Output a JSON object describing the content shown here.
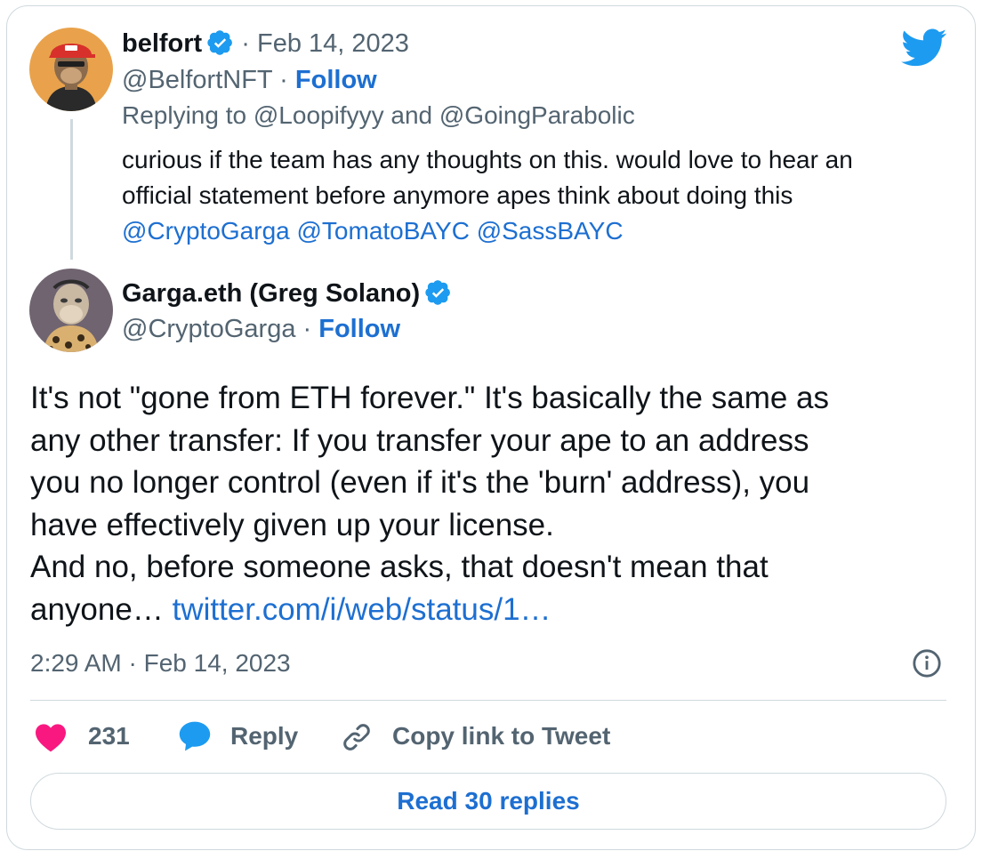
{
  "colors": {
    "link": "#1d6fd1",
    "twitter_blue": "#1d9bf0",
    "like_red": "#f91880",
    "muted": "#536471",
    "border": "#cfd9de"
  },
  "reply_tweet": {
    "author_name": "belfort",
    "dot_date": "· Feb 14, 2023",
    "handle": "@BelfortNFT",
    "dot": "·",
    "follow_label": "Follow",
    "replying_prefix": "Replying to",
    "replying_user1": "@Loopifyyy",
    "replying_and": "and",
    "replying_user2": "@GoingParabolic",
    "text_line1": "curious if the team has any thoughts on this. would love to hear an",
    "text_line2": "official statement before anymore apes think about doing this",
    "mentions": [
      "@CryptoGarga",
      "@TomatoBAYC",
      "@SassBAYC"
    ],
    "avatar_icon": "ape-red-hat-avatar",
    "verified_icon": "verified-badge-icon"
  },
  "main_tweet": {
    "author_name": "Garga.eth (Greg Solano)",
    "handle": "@CryptoGarga",
    "dot": "·",
    "follow_label": "Follow",
    "avatar_icon": "ape-leopard-avatar",
    "lines": [
      "It's not \"gone from ETH forever.\" It's basically the same as",
      "any other transfer: If you transfer your ape to an address",
      "you no longer control (even if it's the 'burn' address), you",
      "have effectively given up your license.",
      "And no, before someone asks, that doesn't mean that"
    ],
    "last_line_prefix": "anyone…",
    "link_text": "twitter.com/i/web/status/1…",
    "timestamp": "2:29 AM · Feb 14, 2023"
  },
  "actions": {
    "like_count": "231",
    "reply_label": "Reply",
    "copy_label": "Copy link to Tweet"
  },
  "read_replies_label": "Read 30 replies"
}
